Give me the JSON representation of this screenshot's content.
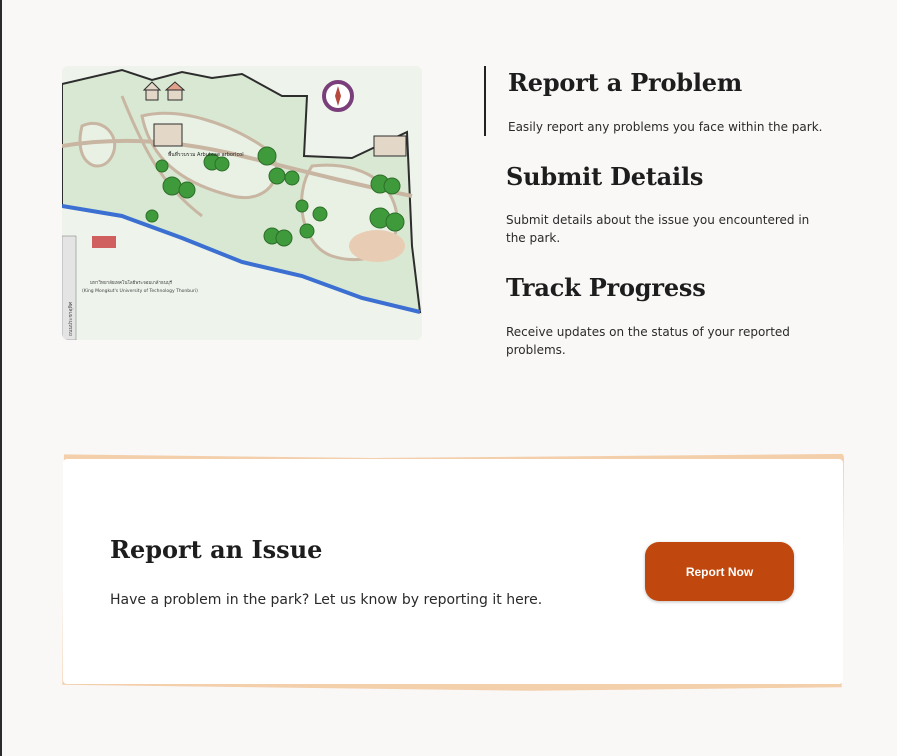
{
  "map": {
    "zone_label_1": "พื้นที่รวบรวม Arbuteae arboricol",
    "zone_label_2": "มหาวิทยาลัยเทคโนโลยีพระจอมเกล้าธนบุรี",
    "zone_label_3": "(King Mongkut's University of Technology Thonburi)",
    "road_label": "ถนนประชาอุทิศ",
    "colors": {
      "lawn": "#d9e8d2",
      "path": "#c8b6a3",
      "water": "#3b6fd1",
      "tree": "#3f9a3b"
    }
  },
  "features": [
    {
      "title": "Report a Problem",
      "description": "Easily report any problems you face within the park."
    },
    {
      "title": "Submit Details",
      "description": "Submit details about the issue you encountered in the park."
    },
    {
      "title": "Track Progress",
      "description": "Receive updates on the status of your reported problems."
    }
  ],
  "cta": {
    "title": "Report an Issue",
    "description": "Have a problem in the park? Let us know by reporting it here.",
    "button_label": "Report Now",
    "accent_color": "#c0470d",
    "frame_color": "#f3cfac"
  }
}
